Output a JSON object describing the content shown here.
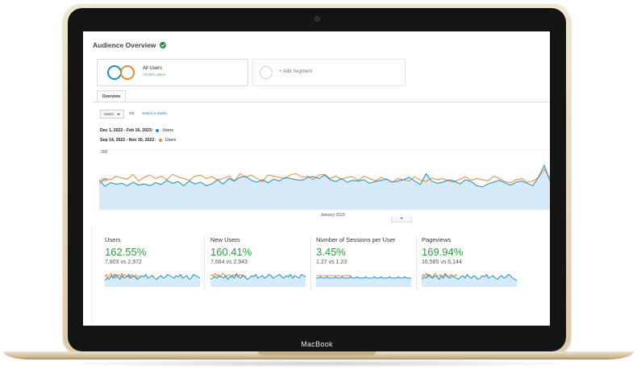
{
  "device": {
    "brand": "MacBook"
  },
  "header": {
    "title": "Audience Overview",
    "status_icon": "verified-check-icon",
    "status_color": "#1e8e3e"
  },
  "segments": {
    "primary": {
      "name": "All Users",
      "subtitle": "+0.00% Users",
      "colors": [
        "#1a8fd1",
        "#f0892a"
      ]
    },
    "add": {
      "label": "+ Add Segment"
    }
  },
  "tabs": [
    {
      "label": "Overview",
      "active": true
    }
  ],
  "controls": {
    "metric_select": "Users",
    "vs_label": "VS.",
    "select_metric_link": "Select a metric"
  },
  "date_ranges": [
    {
      "dates": "Dec 1, 2022 - Feb 16, 2023:",
      "metric": "Users",
      "color": "#1a8fd1"
    },
    {
      "dates": "Sep 14, 2022 - Nov 30, 2022:",
      "metric": "Users",
      "color": "#f0892a"
    }
  ],
  "chart_data": {
    "type": "line",
    "title": "",
    "xlabel": "January 2023",
    "ylabel": "",
    "y_ticks": [
      "200",
      "100"
    ],
    "ylim": [
      0,
      200
    ],
    "grid": true,
    "legend": "none",
    "series": [
      {
        "name": "Dec 1, 2022 - Feb 16, 2023",
        "color": "#1a8fd1",
        "fill": "#d6ebf7",
        "values": [
          100,
          78,
          90,
          85,
          88,
          80,
          92,
          82,
          86,
          80,
          90,
          84,
          98,
          88,
          94,
          80,
          96,
          86,
          92,
          80,
          86,
          100,
          86,
          104,
          96,
          108,
          112,
          98,
          92,
          100,
          90,
          102,
          96,
          108,
          104,
          100,
          98,
          108,
          110,
          104,
          116,
          100,
          94,
          104,
          92,
          98,
          96,
          100,
          88,
          94,
          98,
          102,
          92,
          96,
          100,
          108,
          96,
          84,
          120,
          96,
          88,
          92,
          100,
          96,
          86,
          100,
          94,
          80,
          76,
          86,
          92,
          98,
          90,
          82,
          92,
          96,
          88,
          80,
          110,
          148,
          96
        ]
      },
      {
        "name": "Sep 14, 2022 - Nov 30, 2022",
        "color": "#f0892a",
        "values": [
          86,
          104,
          100,
          112,
          106,
          102,
          118,
          96,
          108,
          116,
          104,
          112,
          100,
          118,
          110,
          104,
          98,
          112,
          116,
          104,
          110,
          100,
          104,
          112,
          96,
          120,
          108,
          116,
          104,
          94,
          116,
          112,
          108,
          104,
          118,
          120,
          108,
          112,
          100,
          116,
          118,
          104,
          112,
          102,
          108,
          110,
          98,
          112,
          104,
          96,
          108,
          102,
          92,
          104,
          100,
          96,
          110,
          98,
          94,
          106,
          100,
          104,
          96,
          92,
          102,
          110,
          98,
          104,
          100,
          96,
          112,
          104,
          94,
          90,
          100,
          104,
          92,
          96,
          108,
          136,
          106
        ]
      }
    ]
  },
  "metric_cards": [
    {
      "label": "Users",
      "pct": "162.55%",
      "vs": "7,803 vs 2,972",
      "spark_blue": [
        4,
        6,
        5,
        8,
        6,
        9,
        7,
        5,
        8,
        6,
        7,
        9,
        6,
        8,
        7,
        5,
        6,
        8,
        7,
        9,
        6,
        7,
        8,
        6,
        5,
        7,
        8,
        6,
        7,
        9,
        8,
        7,
        6,
        8,
        7,
        9,
        6,
        7,
        8,
        5,
        6,
        9,
        8,
        7,
        6
      ],
      "spark_orange": [
        7,
        9,
        6,
        8,
        10,
        7,
        9,
        6,
        8,
        9,
        7,
        10,
        8,
        9,
        7,
        8,
        6,
        9,
        8,
        7,
        9,
        6,
        8,
        7
      ]
    },
    {
      "label": "New Users",
      "pct": "160.41%",
      "vs": "7,664 vs 2,943",
      "spark_blue": [
        5,
        6,
        7,
        6,
        8,
        7,
        6,
        8,
        5,
        7,
        8,
        6,
        9,
        7,
        6,
        8,
        7,
        5,
        6,
        8,
        7,
        9,
        6,
        7,
        8,
        6,
        7,
        9,
        8,
        6,
        7,
        8,
        9,
        7,
        6,
        8,
        7,
        9,
        6,
        8,
        7,
        6,
        9,
        8,
        7
      ],
      "spark_orange": [
        8,
        9,
        7,
        10,
        8,
        9,
        7,
        8,
        10,
        9,
        7,
        8,
        9,
        8,
        7,
        9,
        8,
        10,
        7,
        9,
        8,
        9,
        7,
        8
      ]
    },
    {
      "label": "Number of Sessions per User",
      "pct": "3.45%",
      "vs": "1.27 vs 1.23",
      "spark_blue": [
        6,
        6,
        7,
        6,
        6,
        7,
        6,
        6,
        6,
        7,
        6,
        6,
        7,
        6,
        6,
        6,
        7,
        6,
        6,
        7,
        6,
        6,
        6,
        7,
        6,
        6,
        6,
        7,
        6,
        6,
        7,
        6,
        6,
        6,
        7,
        6,
        6,
        6,
        7,
        6,
        6,
        7,
        6,
        6,
        6
      ],
      "spark_orange": [
        8,
        8,
        8,
        8,
        8,
        8,
        8,
        8,
        8,
        8,
        8,
        8,
        8,
        8,
        8,
        8,
        8,
        8,
        8,
        8,
        8,
        8,
        8,
        8
      ]
    },
    {
      "label": "Pageviews",
      "pct": "169.94%",
      "vs": "16,585 vs 6,144",
      "spark_blue": [
        5,
        7,
        6,
        9,
        7,
        6,
        8,
        7,
        5,
        8,
        6,
        9,
        7,
        6,
        8,
        7,
        6,
        5,
        7,
        8,
        6,
        9,
        7,
        6,
        8,
        7,
        5,
        6,
        8,
        7,
        9,
        6,
        7,
        8,
        6,
        5,
        7,
        8,
        6,
        7,
        9,
        8,
        6,
        5,
        4
      ],
      "spark_orange": [
        7,
        9,
        8,
        10,
        7,
        9,
        8,
        6,
        9,
        10,
        7,
        8,
        9,
        7,
        8,
        10,
        9,
        7,
        8,
        9,
        8,
        7,
        9,
        8
      ]
    }
  ]
}
